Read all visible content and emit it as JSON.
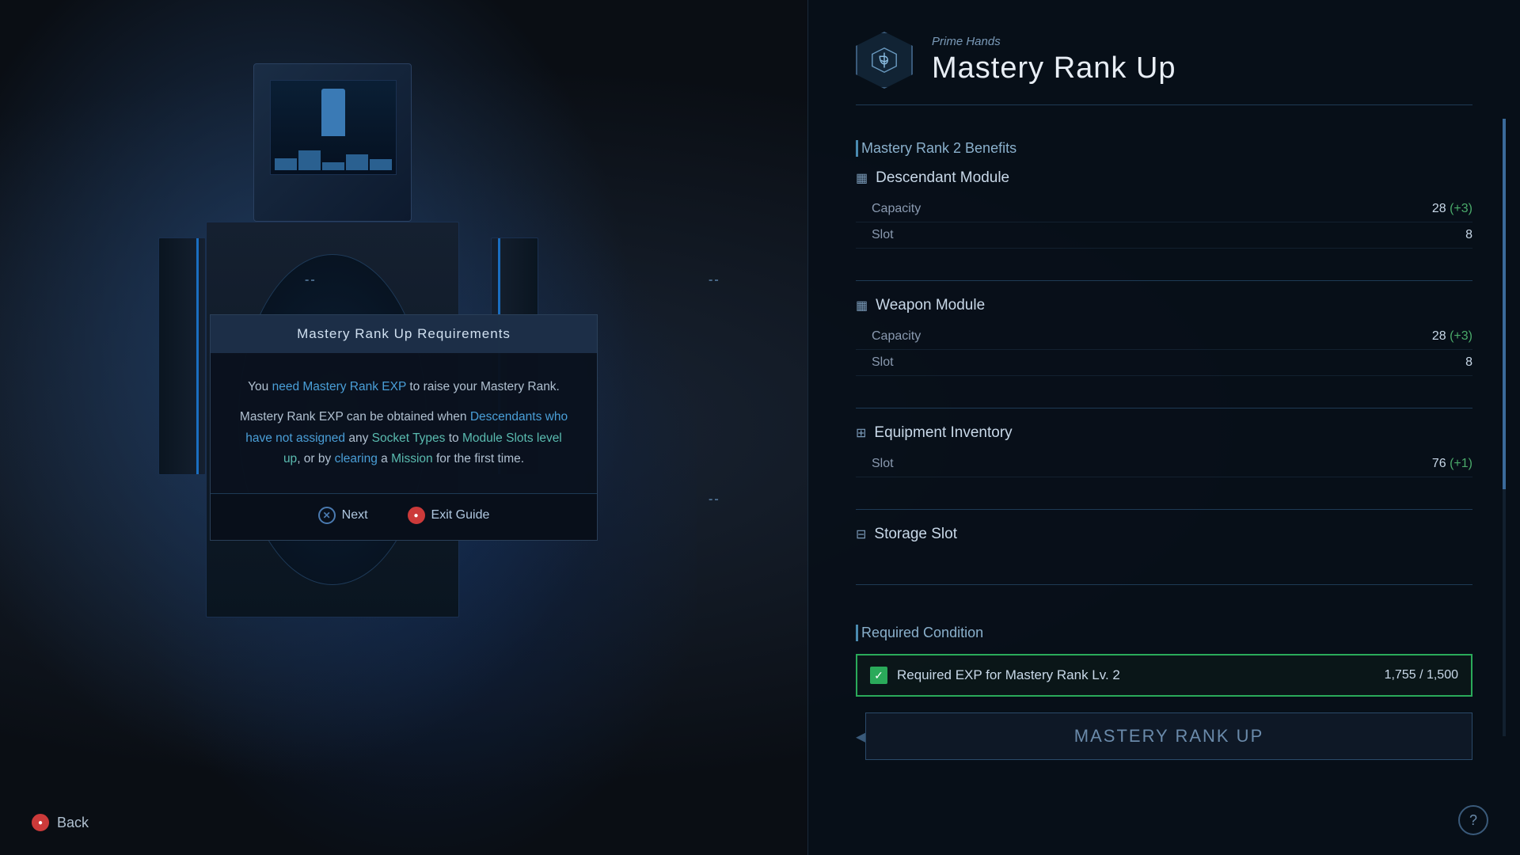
{
  "background": {
    "color": "#0a0e14"
  },
  "header": {
    "subtitle": "Prime Hands",
    "title": "Mastery Rank Up"
  },
  "benefits_section": {
    "label": "Mastery Rank 2 Benefits"
  },
  "descendant_module": {
    "label": "Descendant Module",
    "capacity_label": "Capacity",
    "capacity_value": "28 (+3)",
    "slot_label": "Slot",
    "slot_value": "8"
  },
  "weapon_module": {
    "label": "Weapon Module",
    "capacity_label": "Capacity",
    "capacity_value": "28 (+3)",
    "slot_label": "Slot",
    "slot_value": "8"
  },
  "equipment_inventory": {
    "label": "Equipment Inventory",
    "slot_label": "Slot",
    "slot_value": "76 (+1)"
  },
  "storage_slot": {
    "label": "Storage Slot"
  },
  "required_condition": {
    "section_label": "Required Condition",
    "exp_label": "Required EXP for Mastery Rank Lv. 2",
    "exp_value": "1,755 / 1,500"
  },
  "mastery_btn": {
    "label": "Mastery Rank Up"
  },
  "dialog": {
    "title": "Mastery Rank Up Requirements",
    "body_normal_1": "You ",
    "body_highlight_1": "need Mastery Rank EXP",
    "body_normal_2": " to raise your Mastery Rank.",
    "body_normal_3": "Mastery Rank EXP can be obtained when ",
    "body_highlight_2": "Descendants who have not assigned",
    "body_normal_4": " any ",
    "body_highlight_3": "Socket Types",
    "body_normal_5": " to ",
    "body_highlight_4": "Module Slots level up",
    "body_normal_6": ", or by ",
    "body_highlight_5": "clearing",
    "body_normal_7": " a ",
    "body_highlight_6": "Mission",
    "body_normal_8": " for the first time.",
    "btn_next": "Next",
    "btn_exit": "Exit Guide"
  },
  "back_btn": {
    "label": "Back"
  },
  "corners": {
    "dash": "--"
  }
}
